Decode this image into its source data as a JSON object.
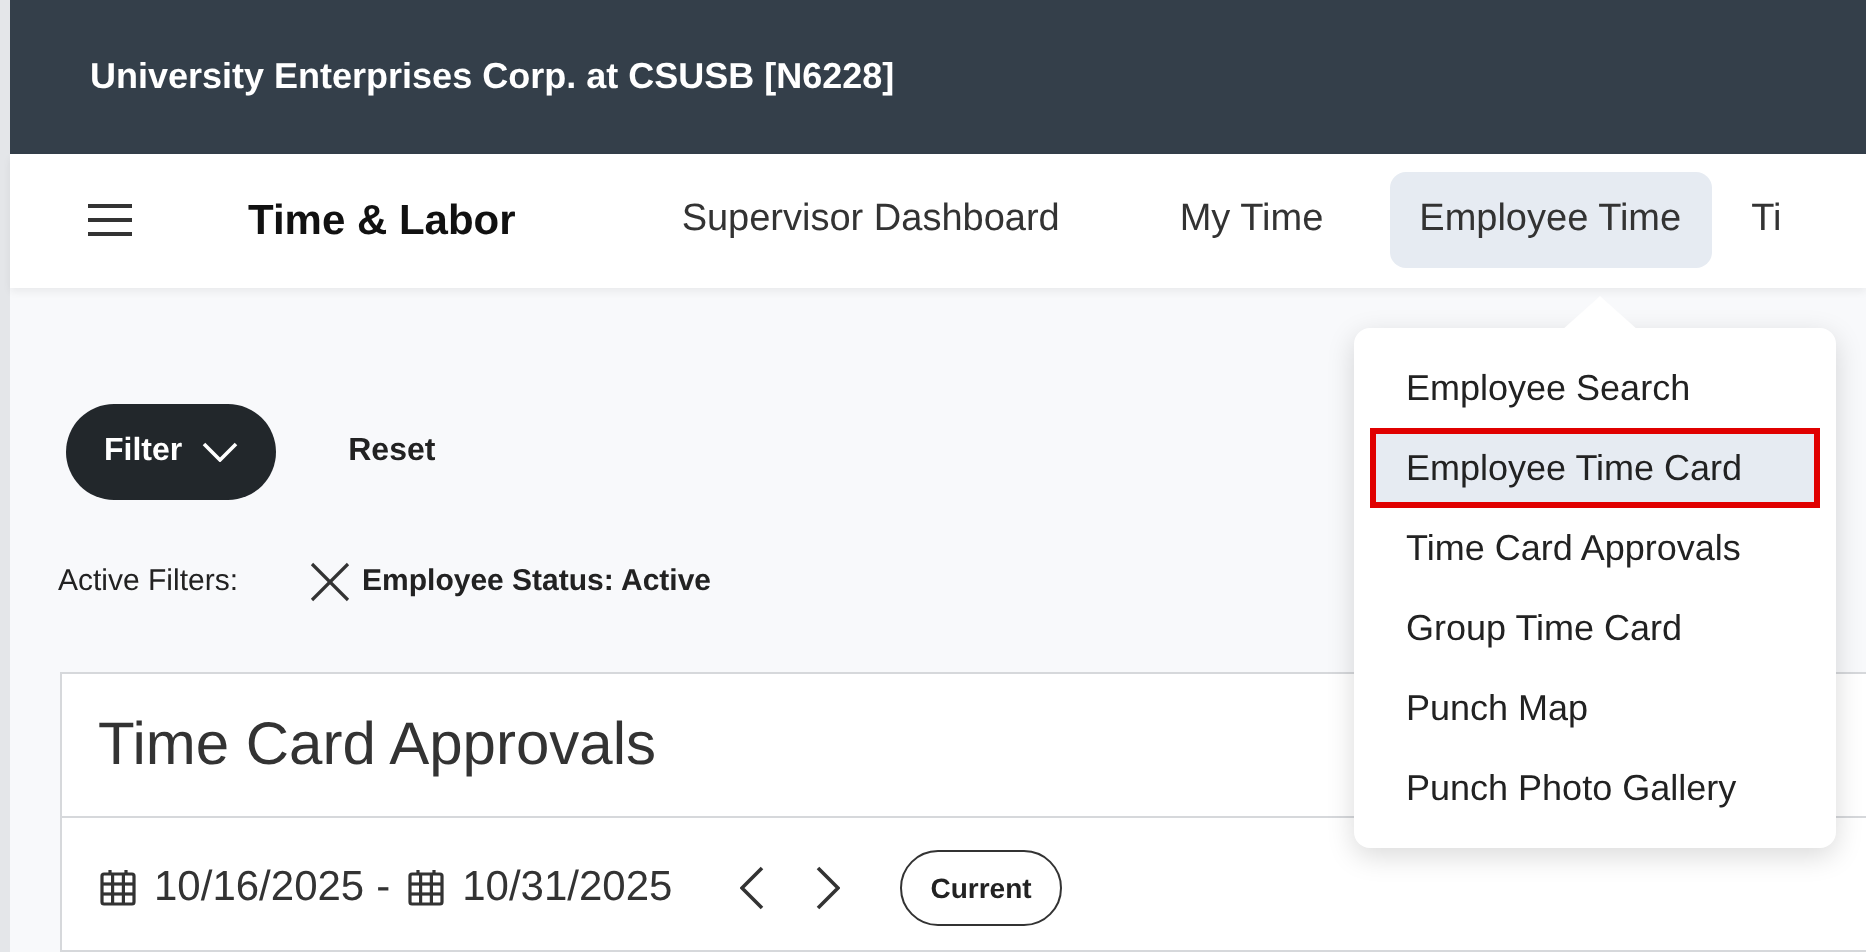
{
  "header": {
    "organization": "University Enterprises Corp. at CSUSB [N6228]"
  },
  "nav": {
    "title": "Time & Labor",
    "tabs": [
      {
        "label": "Supervisor Dashboard",
        "selected": false
      },
      {
        "label": "My Time",
        "selected": false
      },
      {
        "label": "Employee Time",
        "selected": true
      },
      {
        "label": "Ti",
        "selected": false
      }
    ]
  },
  "dropdown": {
    "items": [
      {
        "label": "Employee Search",
        "selected": false
      },
      {
        "label": "Employee Time Card",
        "selected": true
      },
      {
        "label": "Time Card Approvals",
        "selected": false
      },
      {
        "label": "Group Time Card",
        "selected": false
      },
      {
        "label": "Punch Map",
        "selected": false
      },
      {
        "label": "Punch Photo Gallery",
        "selected": false
      }
    ]
  },
  "filters": {
    "filter_button": "Filter",
    "reset_button": "Reset",
    "active_label": "Active Filters:",
    "active": [
      "Employee Status: Active"
    ]
  },
  "card": {
    "title": "Time Card Approvals",
    "start_date": "10/16/2025",
    "separator": "-",
    "end_date": "10/31/2025",
    "current_button": "Current"
  }
}
